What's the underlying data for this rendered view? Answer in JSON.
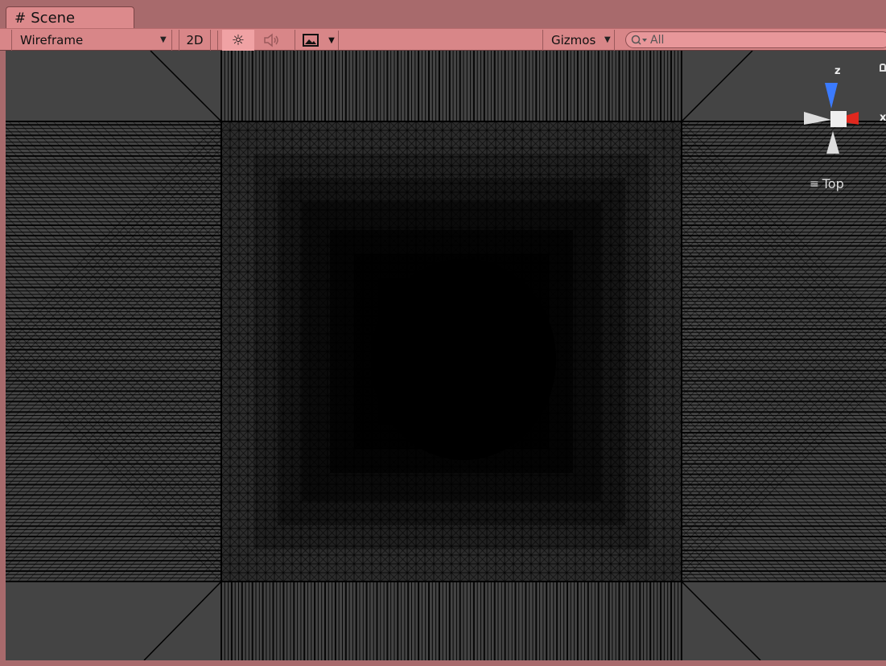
{
  "tab": {
    "title": "Scene",
    "icon": "scene-grid-icon"
  },
  "toolbar": {
    "draw_mode": "Wireframe",
    "btn_2d": "2D",
    "lighting_icon": "sun-icon",
    "audio_icon": "speaker-icon",
    "effects_icon": "image-icon",
    "gizmos": "Gizmos",
    "search_placeholder": "All"
  },
  "gizmo": {
    "z_label": "z",
    "x_label": "x",
    "view_label": "Top",
    "colors": {
      "z": "#3b7bff",
      "x": "#e0281e",
      "neutral": "#dddddd"
    }
  },
  "colors": {
    "panel": "#a86a6c",
    "toolbar": "#d88688",
    "tab": "#dc8a8c",
    "viewport_bg": "#444444",
    "wire": "#000000"
  }
}
